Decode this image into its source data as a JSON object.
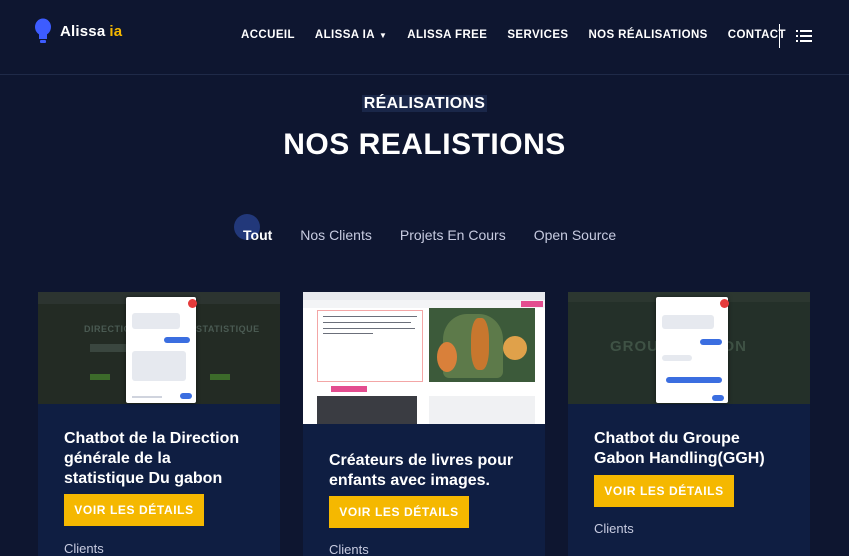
{
  "brand": {
    "name": "Alissa",
    "suffix": "ia"
  },
  "nav": {
    "items": [
      "ACCUEIL",
      "ALISSA IA",
      "ALISSA FREE",
      "SERVICES",
      "NOS RÉALISATIONS",
      "CONTACT"
    ],
    "dropdown_item_index": 1
  },
  "section": {
    "tag": "RÉALISATIONS",
    "title": "NOS REALISTIONS"
  },
  "filters": [
    "Tout",
    "Nos Clients",
    "Projets En Cours",
    "Open Source"
  ],
  "active_filter": "Tout",
  "cards": [
    {
      "title_lines": [
        "Chatbot de la Direction",
        "générale de la",
        "statistique Du gabon"
      ],
      "button": "VOIR LES DÉTAILS",
      "category": "Clients",
      "thumb_text": [
        "DIRECTION",
        "STATISTIQUE"
      ]
    },
    {
      "title_lines": [
        "Créateurs de livres pour",
        "enfants avec images."
      ],
      "button": "VOIR LES DÉTAILS",
      "category": "Clients"
    },
    {
      "title_lines": [
        "Chatbot du Groupe",
        "Gabon Handling(GGH)"
      ],
      "button": "VOIR LES DÉTAILS",
      "category": "Clients",
      "thumb_text": [
        "GROUPE GABON"
      ]
    }
  ],
  "colors": {
    "background": "#0e1630",
    "card": "#0f1e42",
    "accent": "#f5b800"
  },
  "icons": {
    "logo": "lightbulb-icon",
    "menu": "list-menu-icon",
    "dropdown": "chevron-down-icon"
  }
}
